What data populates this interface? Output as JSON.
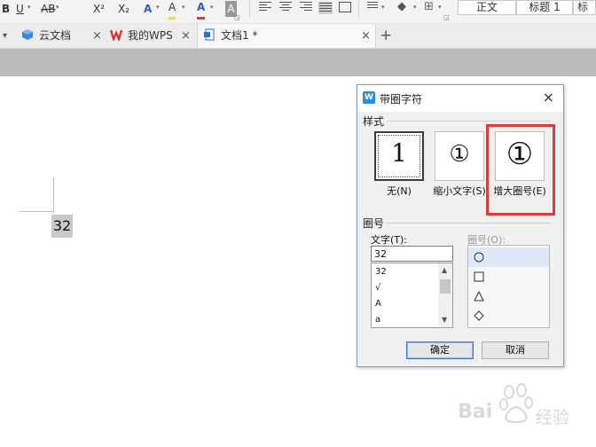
{
  "toolbar": {
    "bold": "B",
    "underline": "U",
    "strike": "AB",
    "superscript": "X²",
    "subscript": "X₂",
    "text_effect": "A",
    "highlight": "A",
    "font_color": "A",
    "char_shading": "A",
    "style_normal": "正文",
    "style_heading1": "标题 1",
    "style_next": "标"
  },
  "tabs": [
    {
      "label": "云文档",
      "close": "×"
    },
    {
      "label": "我的WPS",
      "close": "×"
    },
    {
      "label": "文档1 *",
      "close": "×"
    }
  ],
  "tab_menu_caret": "▾",
  "new_tab": "+",
  "document": {
    "selected_text": "32"
  },
  "dialog": {
    "title": "带圈字符",
    "close": "×",
    "logo": "W",
    "style_group": "样式",
    "style_options": [
      {
        "label": "无(N)",
        "preview": "1"
      },
      {
        "label": "缩小文字(S)",
        "preview": "①"
      },
      {
        "label": "增大圈号(E)",
        "preview": "①"
      }
    ],
    "circle_group": "圈号",
    "text_label": "文字(T):",
    "text_value": "32",
    "text_list": [
      "32",
      "√",
      "A",
      "a"
    ],
    "circle_label": "圈号(O):",
    "ok": "确定",
    "cancel": "取消"
  },
  "colors": {
    "accent": "#2b8de2",
    "highlight_box": "#e03a3a",
    "default_button": "#3c7fd1"
  },
  "watermark": {
    "brand_left": "Bai",
    "brand_right": "经验"
  }
}
